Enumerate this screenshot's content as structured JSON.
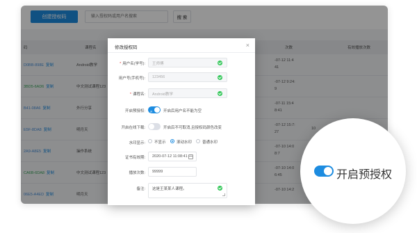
{
  "toolbar": {
    "create_button": "创建授权码",
    "search_placeholder": "输入授权码或用户名搜索",
    "search_button": "搜 索"
  },
  "table": {
    "headers": [
      "码",
      "课程名",
      "",
      "",
      "",
      "次数",
      "有效播放次数"
    ],
    "header_visible": [
      "码",
      "课程名",
      "次数"
    ],
    "last_header": "有效播放次数",
    "copy_label": "复制",
    "rows": [
      {
        "code": "D0BB-898E",
        "course": "Android教学",
        "date": "-07-12 11:4",
        "date2": "41",
        "n1": "",
        "n2": ""
      },
      {
        "code": "3BD5-6AD6",
        "course": "中文测试课程123",
        "date": "-07-12 9:24:",
        "date2": "9",
        "n1": "",
        "n2": ""
      },
      {
        "code": "B41-08A6",
        "course": "外行分享",
        "date": "-07-11 15:4",
        "date2": "8:41",
        "n1": "",
        "n2": ""
      },
      {
        "code": "E5F-8DA8",
        "course": "明月天",
        "date": "-07-12 15:7:",
        "date2": "27",
        "n1": "10",
        "n2": "20"
      },
      {
        "code": "2A9-A8E5",
        "course": "操作系统",
        "date": "-07-10 14:0",
        "date2": "8:7",
        "n1": "",
        "n2": ""
      },
      {
        "code": "CA6B-6DA8",
        "course": "中文测试课程123",
        "date": "-07-10 14:0",
        "date2": "6:45",
        "n1": "",
        "n2": ""
      },
      {
        "code": "06E5-A4ED",
        "course": "明月天",
        "date": "-07-10 14:2",
        "date2": "",
        "n1": "",
        "n2": ""
      },
      {
        "code": "",
        "course": "",
        "date": "-07-10 14:0",
        "date2": "",
        "n1": "",
        "n2": ""
      }
    ]
  },
  "modal": {
    "title": "修改授权码",
    "close": "×",
    "fields": {
      "user_name_label": "用户名(学号):",
      "user_name_value": "王师傅",
      "user_phone_label": "用户号(手机号):",
      "user_phone_value": "123456",
      "course_label": "课程名:",
      "course_value": "Android教学",
      "preauth_label": "开启预授权:",
      "preauth_toggle_text": "开",
      "preauth_desc": "开启后用户名不能为空",
      "download_label": "开启在线下载:",
      "download_desc": "开启后不可取消,且授权码颜色改变",
      "watermark_label": "水印显示:",
      "watermark_options": [
        "不显示",
        "滚动水印",
        "普通水印"
      ],
      "expiry_label": "证书有效期:",
      "expiry_value": "2020-07-12 11:08:41",
      "plays_label": "播放次数:",
      "plays_value": "99999",
      "note_label": "备注:",
      "note_value": "这是王某某人课程。"
    }
  },
  "magnifier": {
    "label": "开启预授权"
  },
  "colors": {
    "primary": "#1d8ce0",
    "success": "#34c759",
    "overlay": "rgba(0,0,0,0.42)"
  }
}
